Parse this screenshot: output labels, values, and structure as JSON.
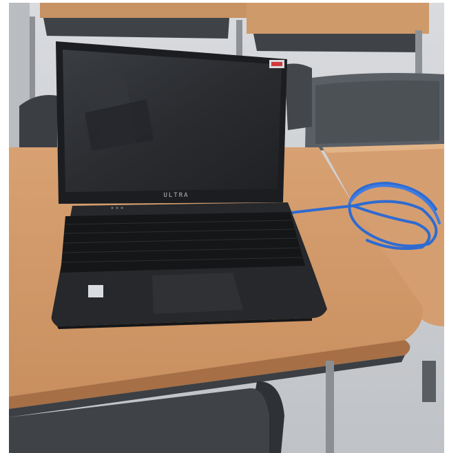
{
  "photo": {
    "laptop_brand": "ULTRA",
    "colors": {
      "floor": "#c9ccd0",
      "desk_wood": "#d29a6c",
      "desk_wood_dark": "#b27a50",
      "laptop_body": "#1e2023",
      "laptop_screen": "#2c2e31",
      "keyboard_keys": "#111214",
      "cable_blue": "#2f6bd0",
      "chair_gray": "#4d5257"
    }
  }
}
